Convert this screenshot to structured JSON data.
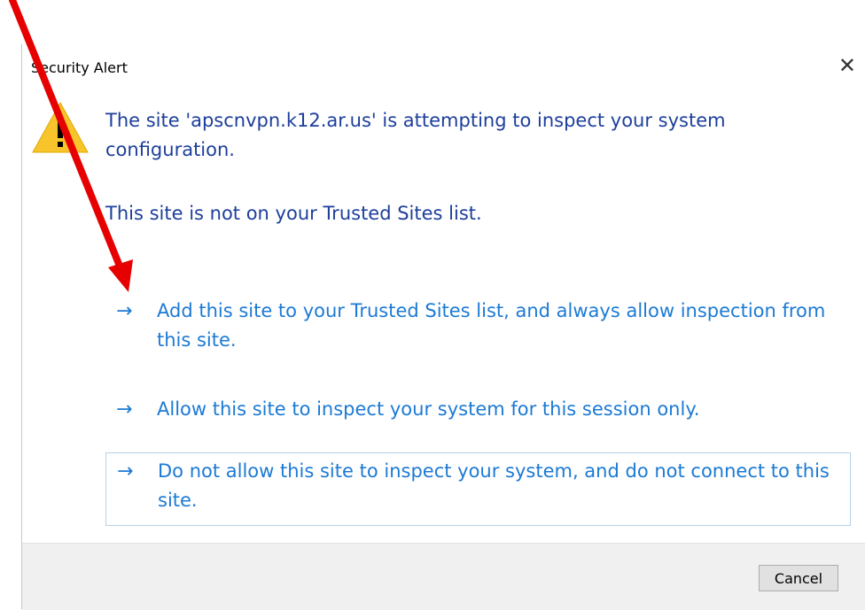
{
  "dialog": {
    "title": "Security Alert",
    "close_icon": "close-icon",
    "warning_icon": "warning-icon",
    "message_line1": "The site 'apscnvpn.k12.ar.us' is attempting to inspect your system configuration.",
    "message_line2": "This site is not on your Trusted Sites list.",
    "options": [
      {
        "arrow": "→",
        "label": "Add this site to your Trusted Sites list, and always allow inspection from this site."
      },
      {
        "arrow": "→",
        "label": "Allow this site to inspect your system for this session only."
      },
      {
        "arrow": "→",
        "label": "Do not allow this site to inspect your system, and do not connect to this site."
      }
    ],
    "cancel_label": "Cancel"
  },
  "annotation": {
    "type": "red-arrow",
    "color": "#e60000"
  },
  "colors": {
    "message_text": "#1d3f9b",
    "link_text": "#1c7ad4",
    "warning_fill": "#f7c52b",
    "footer_bg": "#f0f0f0"
  }
}
